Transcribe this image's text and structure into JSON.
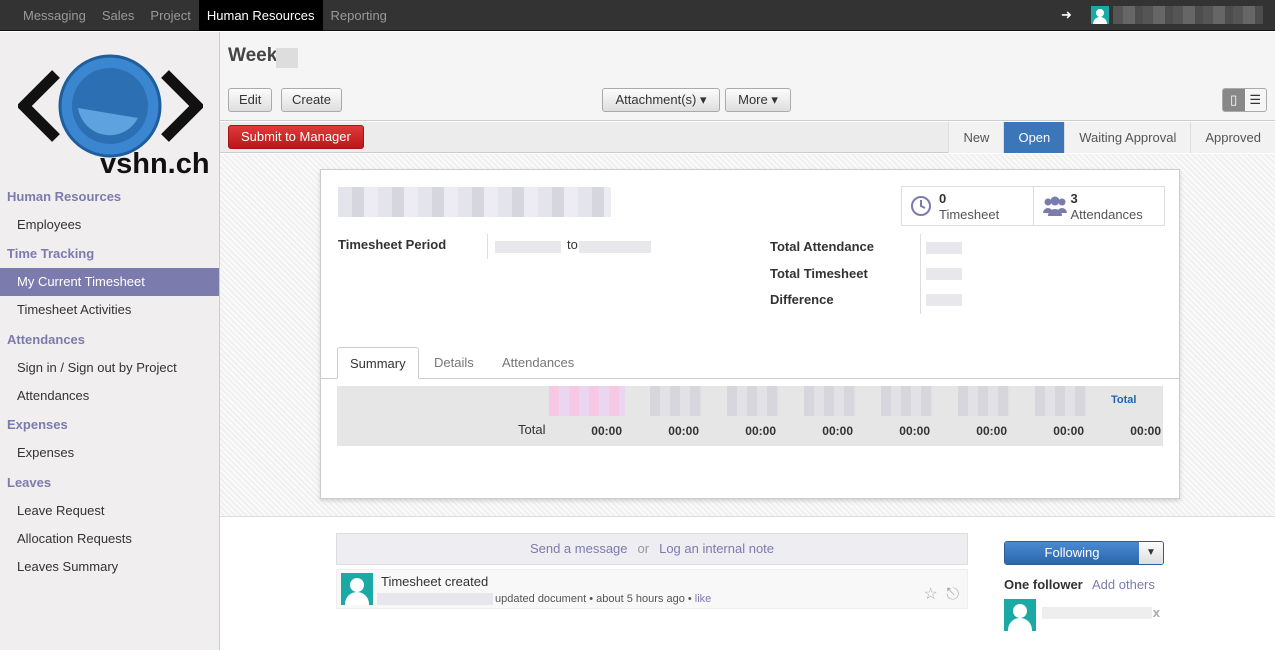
{
  "topbar": {
    "menu": [
      "Messaging",
      "Sales",
      "Project",
      "Human Resources",
      "Reporting"
    ],
    "active": "Human Resources"
  },
  "logo": {
    "text": "vshn.ch"
  },
  "sidebar": {
    "sections": [
      {
        "title": "Human Resources",
        "items": [
          "Employees"
        ]
      },
      {
        "title": "Time Tracking",
        "items": [
          "My Current Timesheet",
          "Timesheet Activities"
        ]
      },
      {
        "title": "Attendances",
        "items": [
          "Sign in / Sign out by Project",
          "Attendances"
        ]
      },
      {
        "title": "Expenses",
        "items": [
          "Expenses"
        ]
      },
      {
        "title": "Leaves",
        "items": [
          "Leave Request",
          "Allocation Requests",
          "Leaves Summary"
        ]
      }
    ],
    "active_item": "My Current Timesheet"
  },
  "header": {
    "title": "Week",
    "buttons": {
      "edit": "Edit",
      "create": "Create",
      "attachments": "Attachment(s) ▾",
      "more": "More ▾"
    }
  },
  "statusbar": {
    "submit": "Submit to Manager",
    "stages": [
      "New",
      "Open",
      "Waiting Approval",
      "Approved"
    ],
    "current_stage": "Open"
  },
  "sheet": {
    "smart": [
      {
        "count": "0",
        "label": "Timesheet",
        "icon": "clock-icon"
      },
      {
        "count": "3",
        "label": "Attendances",
        "icon": "people-icon"
      }
    ],
    "period_label": "Timesheet Period",
    "period_to": "to",
    "total_attendance": "Total Attendance",
    "total_timesheet": "Total Timesheet",
    "difference": "Difference",
    "tabs": [
      "Summary",
      "Details",
      "Attendances"
    ],
    "active_tab": "Summary",
    "summary": {
      "total_header": "Total",
      "row_label": "Total",
      "values": [
        "00:00",
        "00:00",
        "00:00",
        "00:00",
        "00:00",
        "00:00",
        "00:00",
        "00:00"
      ]
    }
  },
  "chatter": {
    "send": "Send a message",
    "or": "or",
    "log": "Log an internal note",
    "message": {
      "title": "Timesheet created",
      "meta": "updated document",
      "sep": "•",
      "time": "about 5 hours ago",
      "like": "like"
    },
    "following": "Following",
    "followers_title": "One follower",
    "add_others": "Add others"
  }
}
